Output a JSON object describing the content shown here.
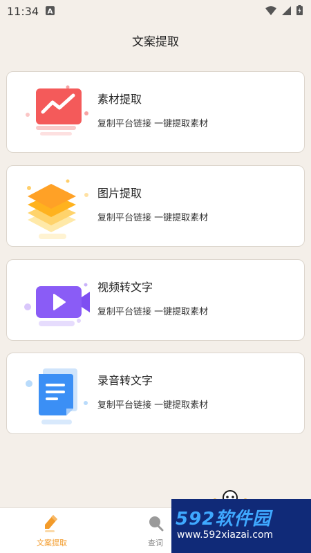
{
  "status_bar": {
    "time": "11:34",
    "icons": [
      "notification-a-icon",
      "wifi-icon",
      "signal-icon",
      "battery-icon"
    ]
  },
  "header": {
    "title": "文案提取"
  },
  "cards": [
    {
      "title": "素材提取",
      "desc": "复制平台链接 一键提取素材",
      "icon": "trend-chart-icon",
      "accent": "#f45a5a"
    },
    {
      "title": "图片提取",
      "desc": "复制平台链接 一键提取素材",
      "icon": "layers-icon",
      "accent": "#ffb21e"
    },
    {
      "title": "视频转文字",
      "desc": "复制平台链接 一键提取素材",
      "icon": "video-camera-icon",
      "accent": "#8a5cf6"
    },
    {
      "title": "录音转文字",
      "desc": "复制平台链接 一键提取素材",
      "icon": "document-icon",
      "accent": "#3b8ff5"
    }
  ],
  "tab_bar": {
    "tabs": [
      {
        "label": "文案提取",
        "icon": "pencil-icon",
        "active": true
      },
      {
        "label": "查词",
        "icon": "search-icon",
        "active": false
      }
    ],
    "active_color": "#f39b2a"
  },
  "watermark": {
    "brand": "592软件园",
    "url": "www.592xiazai.com"
  }
}
